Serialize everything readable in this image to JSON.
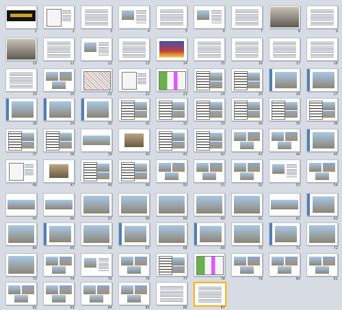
{
  "view": {
    "mode": "Slide Sorter",
    "selected_slide": "87"
  },
  "slides": [
    {
      "n": "1",
      "t": "title"
    },
    {
      "n": "2",
      "t": "plan"
    },
    {
      "n": "3",
      "t": "text"
    },
    {
      "n": "4",
      "t": "photo-text"
    },
    {
      "n": "5",
      "t": "text"
    },
    {
      "n": "6",
      "t": "photo-text"
    },
    {
      "n": "7",
      "t": "text"
    },
    {
      "n": "8",
      "t": "crowd"
    },
    {
      "n": "9",
      "t": "text"
    },
    {
      "n": "10",
      "t": "crowd"
    },
    {
      "n": "11",
      "t": "text"
    },
    {
      "n": "12",
      "t": "photo-text"
    },
    {
      "n": "13",
      "t": "text"
    },
    {
      "n": "14",
      "t": "color-photo"
    },
    {
      "n": "15",
      "t": "text"
    },
    {
      "n": "16",
      "t": "text"
    },
    {
      "n": "17",
      "t": "text"
    },
    {
      "n": "18",
      "t": "text"
    },
    {
      "n": "19",
      "t": "text"
    },
    {
      "n": "20",
      "t": "photos"
    },
    {
      "n": "21",
      "t": "map"
    },
    {
      "n": "22",
      "t": "plan"
    },
    {
      "n": "23",
      "t": "color-map"
    },
    {
      "n": "24",
      "t": "plan-photo"
    },
    {
      "n": "25",
      "t": "plan-photo"
    },
    {
      "n": "26",
      "t": "photo-bar"
    },
    {
      "n": "27",
      "t": "photo-bar"
    },
    {
      "n": "28",
      "t": "photo-bar"
    },
    {
      "n": "29",
      "t": "photo-bar"
    },
    {
      "n": "30",
      "t": "photo-bar"
    },
    {
      "n": "31",
      "t": "plan-photo"
    },
    {
      "n": "32",
      "t": "plan-photo"
    },
    {
      "n": "33",
      "t": "plan-photo"
    },
    {
      "n": "34",
      "t": "plan-photo"
    },
    {
      "n": "35",
      "t": "plan-photo"
    },
    {
      "n": "36",
      "t": "plan-photo"
    },
    {
      "n": "37",
      "t": "plan-photo"
    },
    {
      "n": "38",
      "t": "plan-photo"
    },
    {
      "n": "39",
      "t": "panorama"
    },
    {
      "n": "40",
      "t": "building"
    },
    {
      "n": "41",
      "t": "plan-photo"
    },
    {
      "n": "42",
      "t": "plan-photo"
    },
    {
      "n": "43",
      "t": "photos"
    },
    {
      "n": "44",
      "t": "photos"
    },
    {
      "n": "45",
      "t": "photo-bar"
    },
    {
      "n": "46",
      "t": "plan"
    },
    {
      "n": "47",
      "t": "building"
    },
    {
      "n": "48",
      "t": "plan-photo"
    },
    {
      "n": "49",
      "t": "plan-photo"
    },
    {
      "n": "50",
      "t": "photos"
    },
    {
      "n": "51",
      "t": "photos"
    },
    {
      "n": "52",
      "t": "photos"
    },
    {
      "n": "53",
      "t": "photo-text"
    },
    {
      "n": "54",
      "t": "photos"
    },
    {
      "n": "55",
      "t": "panorama"
    },
    {
      "n": "56",
      "t": "panorama"
    },
    {
      "n": "57",
      "t": "photo"
    },
    {
      "n": "58",
      "t": "photo"
    },
    {
      "n": "59",
      "t": "photo"
    },
    {
      "n": "60",
      "t": "photo"
    },
    {
      "n": "61",
      "t": "photo"
    },
    {
      "n": "62",
      "t": "panorama"
    },
    {
      "n": "63",
      "t": "photo-bar"
    },
    {
      "n": "64",
      "t": "photo"
    },
    {
      "n": "65",
      "t": "photo-bar"
    },
    {
      "n": "66",
      "t": "photo"
    },
    {
      "n": "67",
      "t": "photo-bar"
    },
    {
      "n": "68",
      "t": "photo"
    },
    {
      "n": "69",
      "t": "photo-bar"
    },
    {
      "n": "70",
      "t": "photo"
    },
    {
      "n": "71",
      "t": "photo-bar"
    },
    {
      "n": "72",
      "t": "photo"
    },
    {
      "n": "73",
      "t": "photo"
    },
    {
      "n": "74",
      "t": "photos"
    },
    {
      "n": "75",
      "t": "photo-text"
    },
    {
      "n": "76",
      "t": "photos"
    },
    {
      "n": "77",
      "t": "plan-photo"
    },
    {
      "n": "78",
      "t": "color-map"
    },
    {
      "n": "79",
      "t": "photos"
    },
    {
      "n": "80",
      "t": "photos"
    },
    {
      "n": "81",
      "t": "photos"
    },
    {
      "n": "82",
      "t": "photos"
    },
    {
      "n": "83",
      "t": "photos"
    },
    {
      "n": "84",
      "t": "photos"
    },
    {
      "n": "85",
      "t": "photos"
    },
    {
      "n": "86",
      "t": "text"
    },
    {
      "n": "87",
      "t": "text"
    }
  ],
  "colors": {
    "background": "#d6dbe4",
    "selection": "#f2b233"
  }
}
